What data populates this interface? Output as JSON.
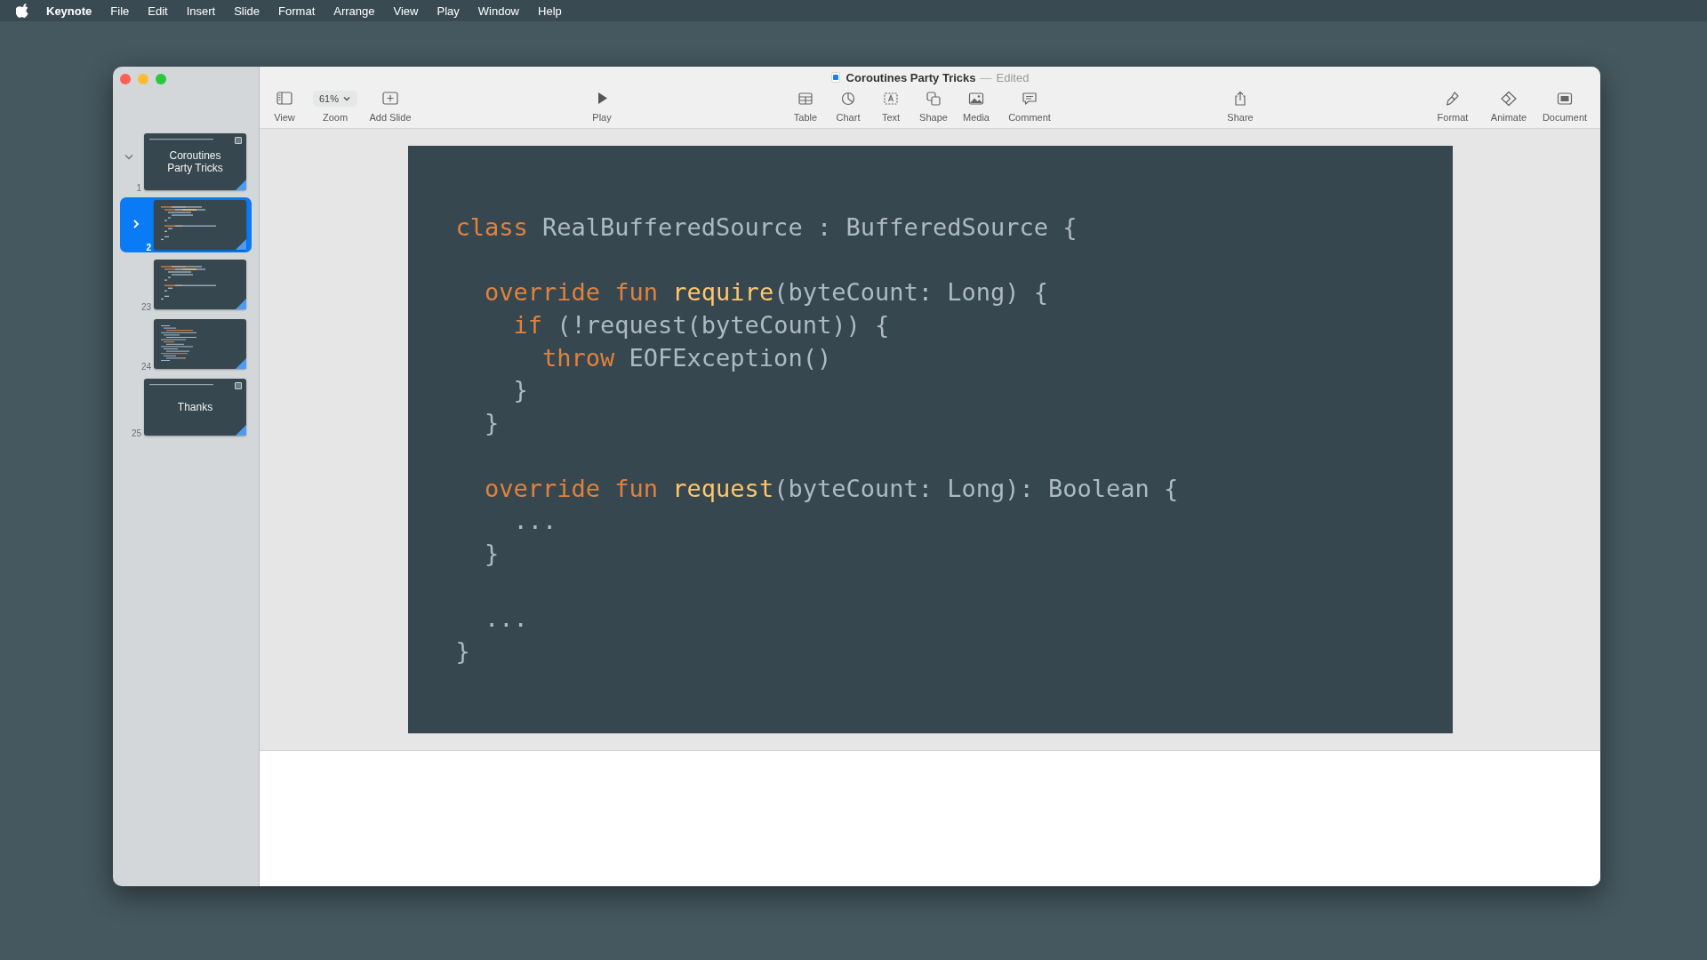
{
  "menu_bar": {
    "app": "Keynote",
    "items": [
      "File",
      "Edit",
      "Insert",
      "Slide",
      "Format",
      "Arrange",
      "View",
      "Play",
      "Window",
      "Help"
    ]
  },
  "window": {
    "title": "Coroutines Party Tricks",
    "separator": "—",
    "status": "Edited"
  },
  "toolbar": {
    "groups": [
      [
        {
          "label": "View"
        },
        {
          "label": "Zoom",
          "value": "61%"
        },
        {
          "label": "Add Slide"
        }
      ],
      [
        {
          "label": "Play"
        }
      ],
      [
        {
          "label": "Table"
        },
        {
          "label": "Chart"
        },
        {
          "label": "Text"
        },
        {
          "label": "Shape"
        },
        {
          "label": "Media"
        },
        {
          "label": "Comment"
        }
      ],
      [
        {
          "label": "Share"
        }
      ],
      [
        {
          "label": "Format"
        },
        {
          "label": "Animate"
        },
        {
          "label": "Document"
        }
      ]
    ]
  },
  "navigator": {
    "slides": [
      {
        "number": "1",
        "kind": "title",
        "title": "Coroutines Party Tricks",
        "selected": false,
        "expanded": true,
        "collapsed": false,
        "children": [
          {
            "number": "2",
            "kind": "code",
            "selected": true,
            "expanded": false,
            "collapsed": true
          },
          {
            "number": "23",
            "kind": "code",
            "selected": false,
            "expanded": false,
            "collapsed": false
          },
          {
            "number": "24",
            "kind": "listing",
            "selected": false,
            "expanded": false,
            "collapsed": false
          }
        ]
      },
      {
        "number": "25",
        "kind": "title",
        "title": "Thanks",
        "selected": false,
        "expanded": false,
        "collapsed": false
      }
    ]
  },
  "slide": {
    "code_lines": [
      {
        "kind": "code",
        "tokens": [
          {
            "kind": "keyword",
            "text": "class"
          },
          {
            "kind": "plain",
            "text": " RealBufferedSource : BufferedSource {"
          }
        ]
      },
      {
        "kind": "blank"
      },
      {
        "kind": "code",
        "tokens": [
          {
            "kind": "keyword",
            "text": "  override fun "
          },
          {
            "kind": "function",
            "text": "require"
          },
          {
            "kind": "plain",
            "text": "(byteCount: Long) {"
          }
        ]
      },
      {
        "kind": "code",
        "tokens": [
          {
            "kind": "keyword",
            "text": "    if"
          },
          {
            "kind": "plain",
            "text": " (!request(byteCount)) {"
          }
        ]
      },
      {
        "kind": "code",
        "tokens": [
          {
            "kind": "keyword",
            "text": "      throw"
          },
          {
            "kind": "plain",
            "text": " EOFException()"
          }
        ]
      },
      {
        "kind": "code",
        "tokens": [
          {
            "kind": "plain",
            "text": "    }"
          }
        ]
      },
      {
        "kind": "code",
        "tokens": [
          {
            "kind": "plain",
            "text": "  }"
          }
        ]
      },
      {
        "kind": "blank"
      },
      {
        "kind": "code",
        "tokens": [
          {
            "kind": "keyword",
            "text": "  override fun "
          },
          {
            "kind": "function",
            "text": "request"
          },
          {
            "kind": "plain",
            "text": "(byteCount: Long): Boolean {"
          }
        ]
      },
      {
        "kind": "code",
        "tokens": [
          {
            "kind": "plain",
            "text": "    ..."
          }
        ]
      },
      {
        "kind": "code",
        "tokens": [
          {
            "kind": "plain",
            "text": "  }"
          }
        ]
      },
      {
        "kind": "blank"
      },
      {
        "kind": "code",
        "tokens": [
          {
            "kind": "plain",
            "text": "  ..."
          }
        ]
      },
      {
        "kind": "code",
        "tokens": [
          {
            "kind": "plain",
            "text": "}"
          }
        ]
      }
    ]
  }
}
